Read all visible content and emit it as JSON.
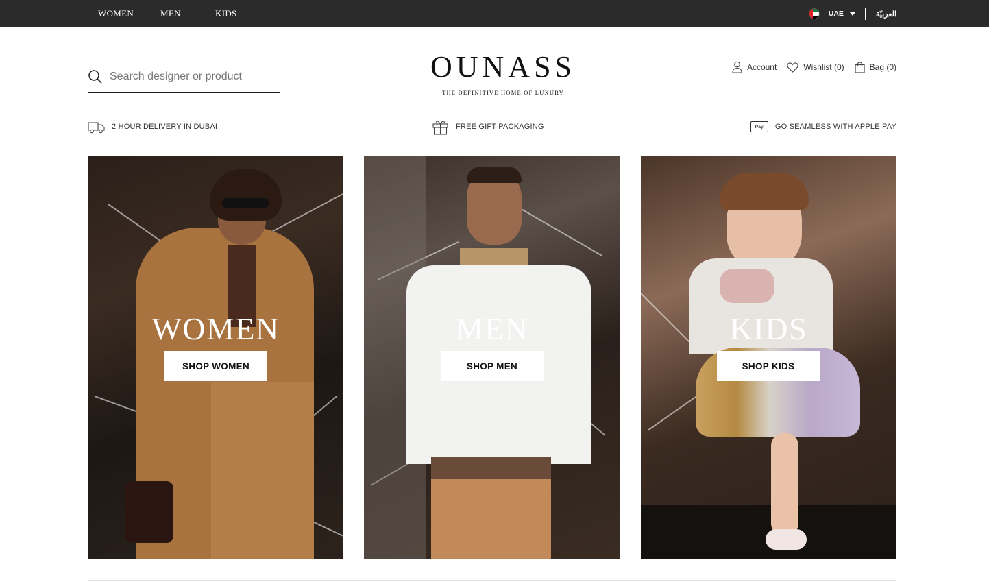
{
  "topbar": {
    "nav": [
      {
        "label": "WOMEN"
      },
      {
        "label": "MEN"
      },
      {
        "label": "KIDS"
      }
    ],
    "country": "UAE",
    "language": "العربيّة"
  },
  "header": {
    "search_placeholder": "Search designer or product",
    "logo": "OUNASS",
    "tagline": "THE DEFINITIVE HOME OF LUXURY",
    "account_label": "Account",
    "wishlist_label": "Wishlist (0)",
    "bag_label": "Bag (0)"
  },
  "usp": {
    "delivery": "2 HOUR DELIVERY IN DUBAI",
    "gift": "FREE GIFT PACKAGING",
    "applepay_badge": "Pay",
    "applepay": "GO SEAMLESS WITH APPLE PAY"
  },
  "tiles": [
    {
      "title": "WOMEN",
      "button": "SHOP WOMEN"
    },
    {
      "title": "MEN",
      "button": "SHOP MEN"
    },
    {
      "title": "KIDS",
      "button": "SHOP KIDS"
    }
  ],
  "colors": {
    "topbar": "#2b2b2b",
    "text": "#1a1a1a",
    "button_bg": "#ffffff"
  }
}
